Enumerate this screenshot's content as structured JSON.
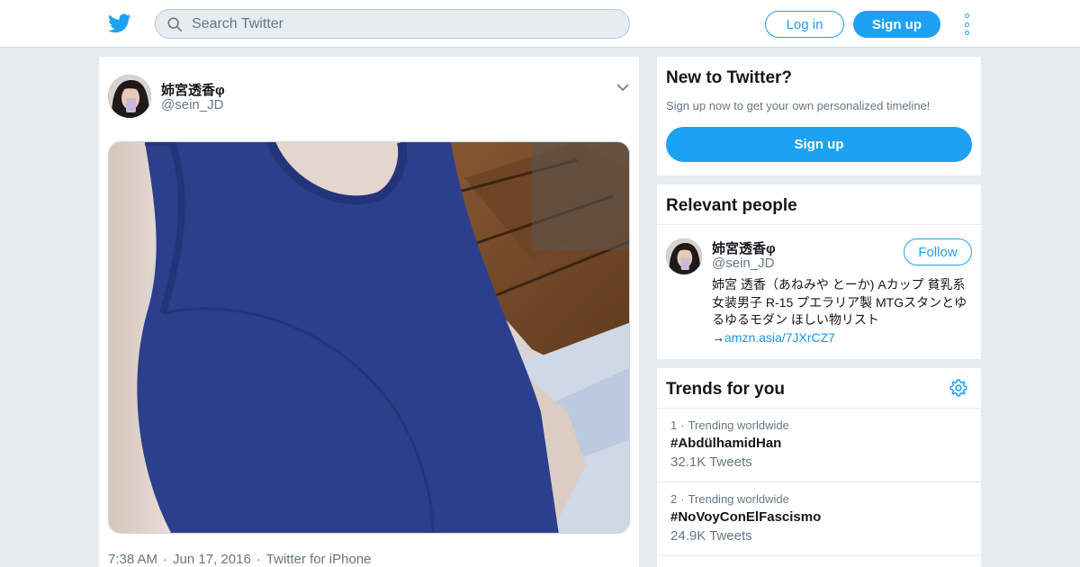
{
  "header": {
    "logo_icon": "twitter-bird-icon",
    "search_placeholder": "Search Twitter",
    "login_label": "Log in",
    "signup_label": "Sign up",
    "more_icon": "vertical-dots-icon",
    "accent_color": "#1da1f2"
  },
  "tweet": {
    "author_name": "姉宮透香φ",
    "author_handle": "@sein_JD",
    "menu_icon": "chevron-down-icon",
    "time": "7:38 AM",
    "date": "Jun 17, 2016",
    "source": "Twitter for iPhone",
    "separator": "·"
  },
  "signup_panel": {
    "title": "New to Twitter?",
    "subtitle": "Sign up now to get your own personalized timeline!",
    "button_label": "Sign up"
  },
  "people_panel": {
    "title": "Relevant people",
    "name": "姉宮透香φ",
    "handle": "@sein_JD",
    "follow_label": "Follow",
    "bio_text": "姉宮 透香（あねみや とーか) Aカップ 貧乳系女装男子 R-15 プエラリア製 MTGスタンとゆるゆるモダン ほしい物リスト→",
    "bio_link": "amzn.asia/7JXrCZ7"
  },
  "trends_panel": {
    "title": "Trends for you",
    "settings_icon": "gear-icon",
    "items": [
      {
        "rank": "1",
        "sep": "·",
        "context": "Trending worldwide",
        "tag": "#AbdülhamidHan",
        "count": "32.1K Tweets"
      },
      {
        "rank": "2",
        "sep": "·",
        "context": "Trending worldwide",
        "tag": "#NoVoyConElFascismo",
        "count": "24.9K Tweets"
      }
    ]
  }
}
